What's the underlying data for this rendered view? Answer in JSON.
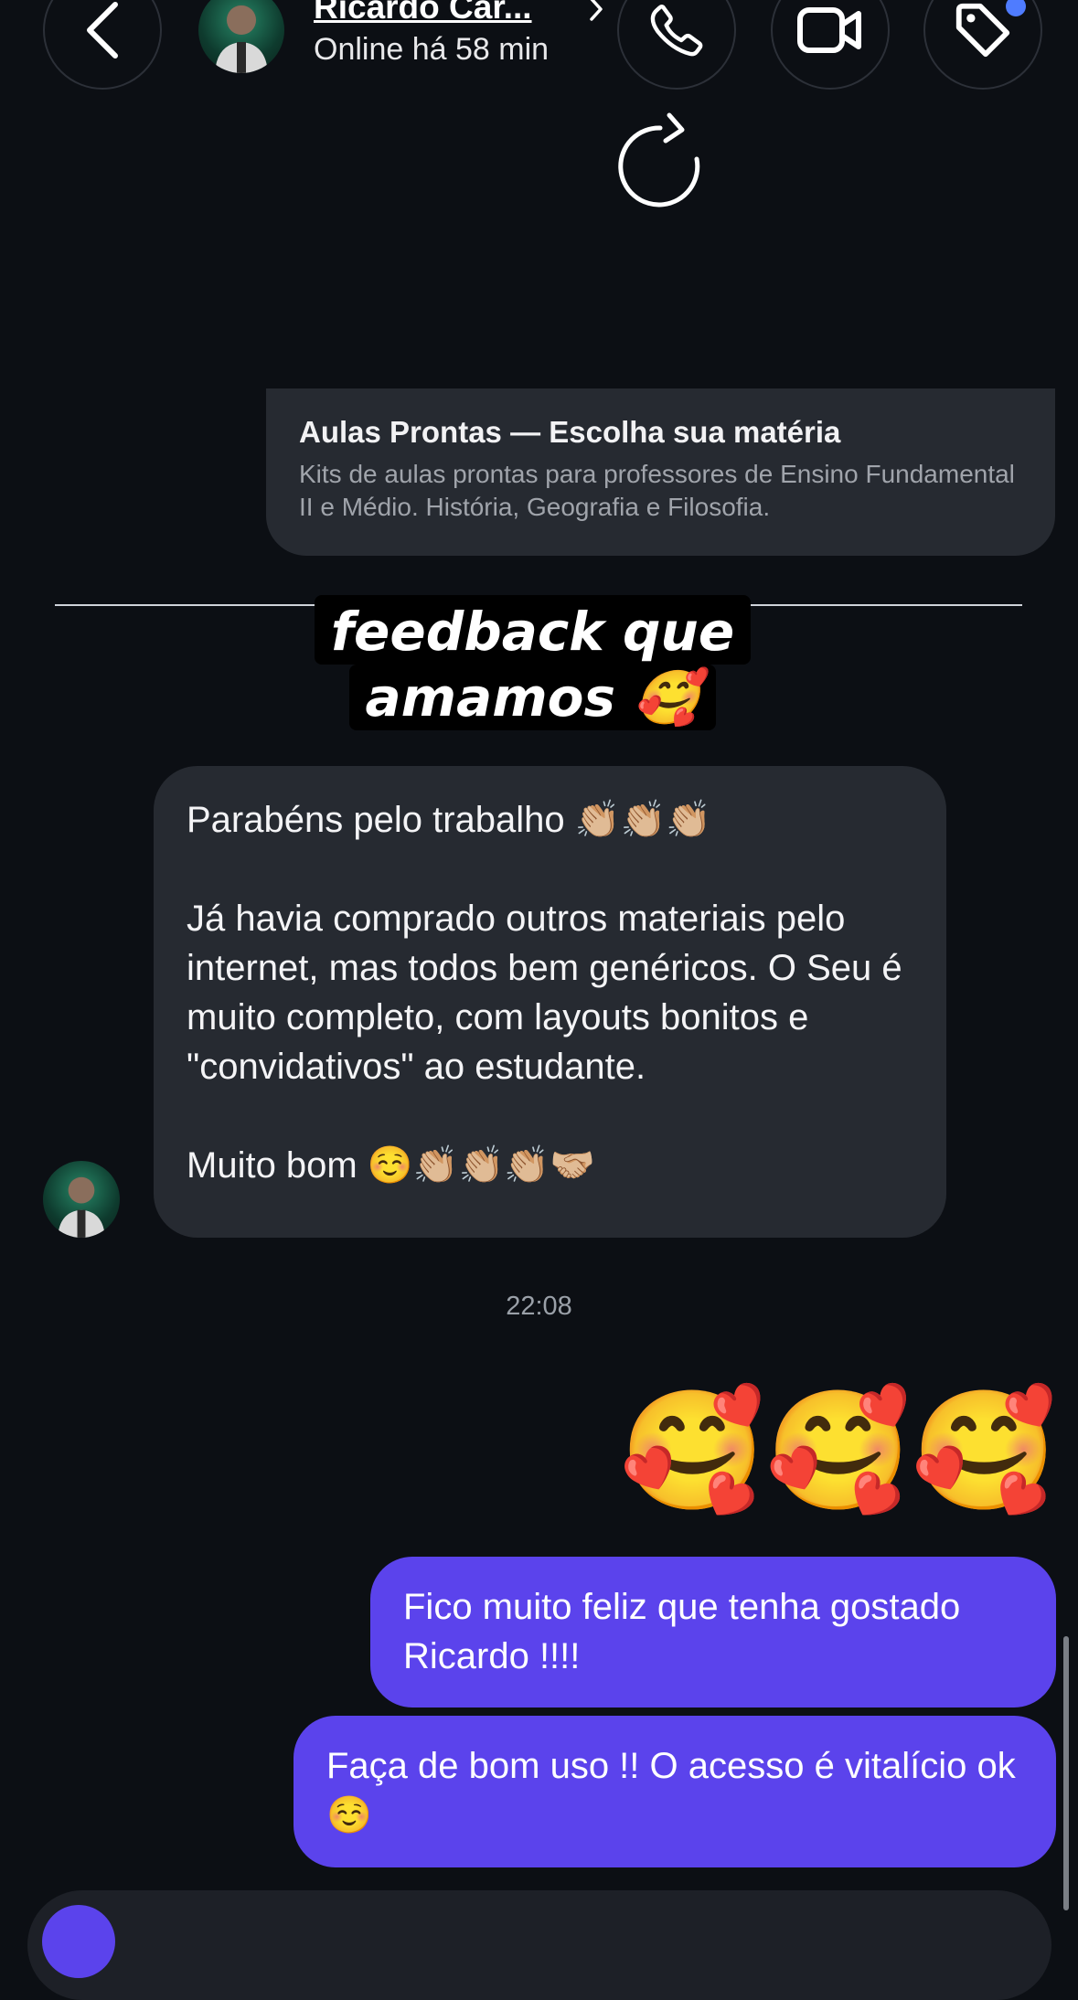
{
  "header": {
    "contact_name": "Ricardo Car...",
    "status": "Online há 58 min",
    "icons": {
      "back": "chevron-left-icon",
      "chevron": "chevron-right-icon",
      "call": "phone-icon",
      "video": "video-camera-icon",
      "tag": "tag-icon"
    },
    "tag_badge_color": "#4f7cff"
  },
  "loading_icon": "refresh-icon",
  "link_preview": {
    "title": "Aulas Prontas — Escolha sua matéria",
    "description": "Kits de aulas prontas para professores de Ensino Fundamental II e Médio. História, Geografia e Filosofia."
  },
  "overlay": {
    "line1": "feedback que",
    "line2": "amamos 🥰"
  },
  "received_message": {
    "p1": "Parabéns pelo trabalho 👏🏼👏🏼👏🏼",
    "p2": "Já havia comprado outros materiais pelo internet, mas todos bem genéricos. O Seu é muito completo, com layouts bonitos e \"convidativos\" ao estudante.",
    "p3": "Muito bom ☺️👏🏼👏🏼👏🏼🤝🏼"
  },
  "timestamp": "22:08",
  "emoji_message": "🥰🥰🥰",
  "sent_messages": [
    "Fico muito feliz que tenha gostado Ricardo !!!!",
    "Faça de bom uso !! O acesso é vitalício ok ☺️"
  ],
  "colors": {
    "background": "#0c0f14",
    "incoming_bubble": "#262a31",
    "outgoing_bubble": "#5b43ec"
  }
}
